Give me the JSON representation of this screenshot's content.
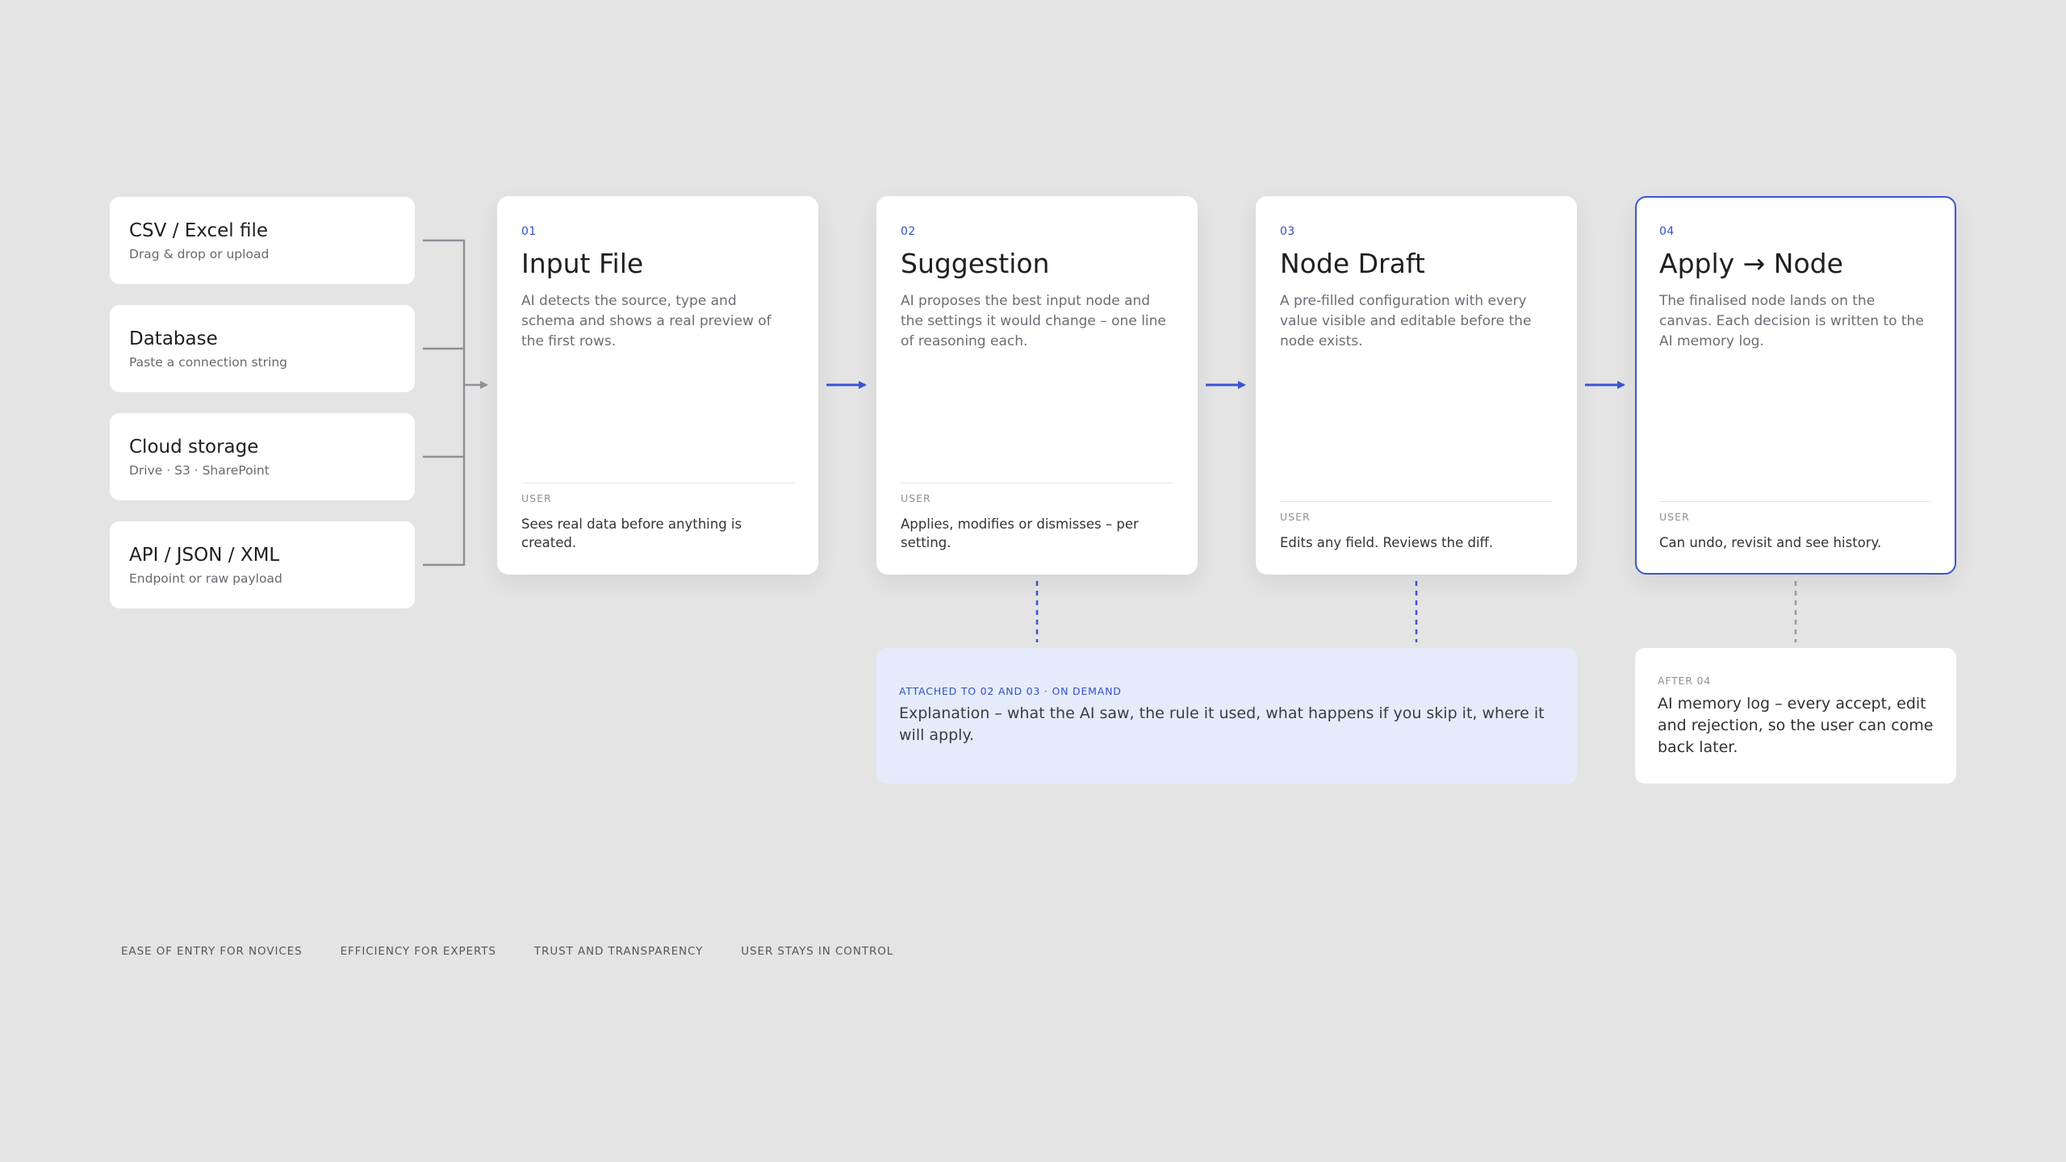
{
  "colors": {
    "background": "#e4e4e4",
    "card": "#ffffff",
    "accent": "#3a56d4",
    "note_background": "#e5ebfa",
    "connector_gray": "#8e9196"
  },
  "sources": [
    {
      "title": "CSV / Excel file",
      "subtitle": "Drag & drop or upload"
    },
    {
      "title": "Database",
      "subtitle": "Paste a connection string"
    },
    {
      "title": "Cloud storage",
      "subtitle": "Drive · S3 · SharePoint"
    },
    {
      "title": "API / JSON / XML",
      "subtitle": "Endpoint or raw payload"
    }
  ],
  "steps": [
    {
      "number": "01",
      "title": "Input File",
      "description": "AI detects the source, type and schema and shows a real preview of the first rows.",
      "role": "USER",
      "user_text": "Sees real data before anything is created."
    },
    {
      "number": "02",
      "title": "Suggestion",
      "description": "AI proposes the best input node and the settings it would change – one line of reasoning each.",
      "role": "USER",
      "user_text": "Applies, modifies or dismisses – per setting."
    },
    {
      "number": "03",
      "title": "Node Draft",
      "description": "A pre-filled configuration with every value visible and editable before the node exists.",
      "role": "USER",
      "user_text": "Edits any field. Reviews the diff."
    },
    {
      "number": "04",
      "title": "Apply → Node",
      "description": "The finalised node lands on the canvas. Each decision is written to the AI memory log.",
      "role": "USER",
      "user_text": "Can undo, revisit and see history."
    }
  ],
  "notes": {
    "explanation": {
      "label": "ATTACHED TO 02 AND 03 · ON DEMAND",
      "text": "Explanation – what the AI saw, the rule it used, what happens if you skip it, where it will apply."
    },
    "memory": {
      "label": "AFTER 04",
      "text": "AI memory log – every accept, edit and rejection, so the user can come back later."
    }
  },
  "principles": [
    "EASE OF ENTRY FOR NOVICES",
    "EFFICIENCY FOR EXPERTS",
    "TRUST AND TRANSPARENCY",
    "USER STAYS IN CONTROL"
  ],
  "icons": {
    "arrow": "arrow-right-icon",
    "connector": "bracket-connector"
  }
}
